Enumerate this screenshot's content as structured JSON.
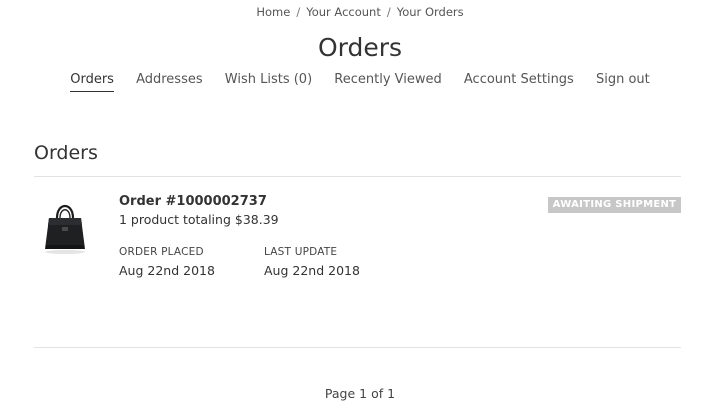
{
  "breadcrumb": {
    "items": [
      "Home",
      "Your Account",
      "Your Orders"
    ],
    "separator": "/"
  },
  "page": {
    "title": "Orders"
  },
  "account_nav": {
    "items": [
      {
        "label": "Orders",
        "active": true
      },
      {
        "label": "Addresses",
        "active": false
      },
      {
        "label": "Wish Lists (0)",
        "active": false
      },
      {
        "label": "Recently Viewed",
        "active": false
      },
      {
        "label": "Account Settings",
        "active": false
      },
      {
        "label": "Sign out",
        "active": false
      }
    ]
  },
  "orders_section": {
    "title": "Orders",
    "orders": [
      {
        "number": "Order #1000002737",
        "summary": "1 product totaling $38.39",
        "placed_label": "ORDER PLACED",
        "placed_value": "Aug 22nd 2018",
        "updated_label": "LAST UPDATE",
        "updated_value": "Aug 22nd 2018",
        "status": "AWAITING SHIPMENT",
        "thumbnail_icon": "handbag-icon"
      }
    ]
  },
  "pagination": {
    "text": "Page 1 of 1"
  },
  "colors": {
    "text": "#333333",
    "muted": "#555555",
    "divider": "#e2e2e2",
    "status_badge_bg": "#c7c7c7",
    "status_badge_text": "#ffffff"
  }
}
